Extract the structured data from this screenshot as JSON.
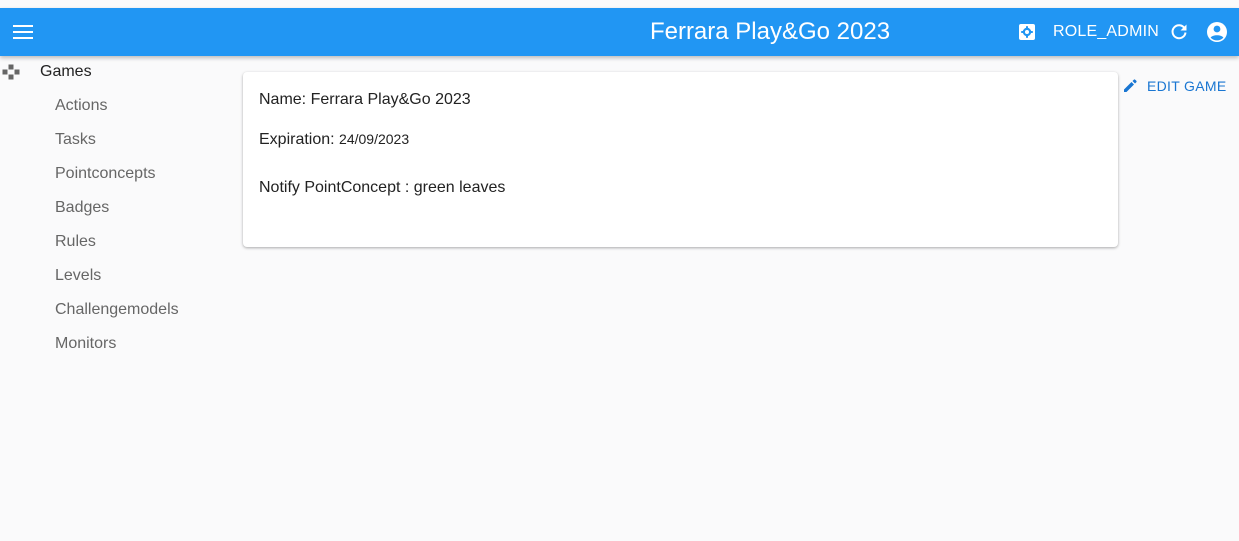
{
  "header": {
    "title": "Ferrara Play&Go 2023",
    "role": "ROLE_ADMIN",
    "icons": [
      "menu-icon",
      "settings-icon",
      "refresh-icon",
      "account-circle-icon"
    ],
    "background_color": "#2196f3"
  },
  "sidebar": {
    "root": {
      "label": "Games",
      "icon": "gamepad-icon"
    },
    "items": [
      {
        "label": "Actions"
      },
      {
        "label": "Tasks"
      },
      {
        "label": "Pointconcepts"
      },
      {
        "label": "Badges"
      },
      {
        "label": "Rules"
      },
      {
        "label": "Levels"
      },
      {
        "label": "Challengemodels"
      },
      {
        "label": "Monitors"
      }
    ]
  },
  "game": {
    "name_label": "Name:",
    "name_value": "Ferrara Play&Go 2023",
    "expiration_label": "Expiration:",
    "expiration_value": "24/09/2023",
    "notify_label": "Notify PointConcept :",
    "notify_value": "green leaves"
  },
  "actions": {
    "edit_label": "EDIT GAME",
    "edit_icon": "pencil-icon",
    "accent_color": "#1976d2"
  }
}
